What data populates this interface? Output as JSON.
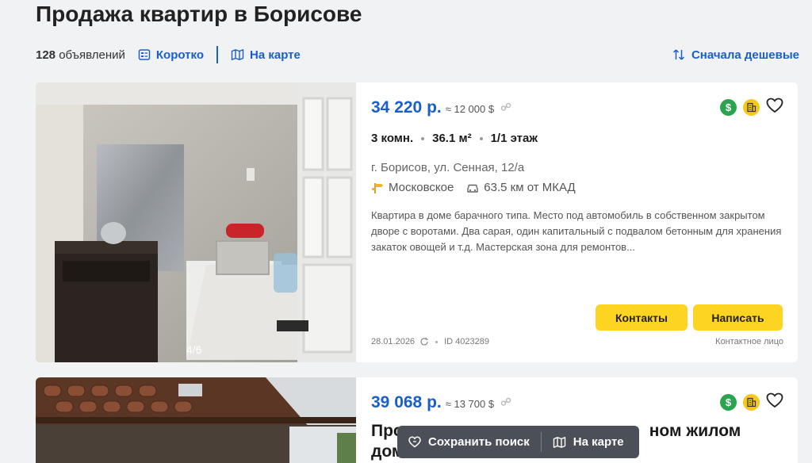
{
  "page": {
    "title": "Продажа квартир в Борисове"
  },
  "toolbar": {
    "count_number": "128",
    "count_label": "объявлений",
    "short_view_label": "Коротко",
    "map_label": "На карте",
    "sort_label": "Сначала дешевые"
  },
  "listings": [
    {
      "price": "34 220 р.",
      "price_usd": "≈ 12 000 $",
      "rooms": "3 комн.",
      "area": "36.1 м²",
      "floor": "1/1 этаж",
      "address": "г. Борисов, ул. Сенная, 12/а",
      "direction": "Московское",
      "distance": "63.5 км от МКАД",
      "description": "Квартира в доме барачного типа. Место под автомобиль в собственном закрытом дворе с воротами. Два сарая, один капитальный с подвалом бетонным для хранения закаток овощей и т.д. Мастерская зона для ремонтов...",
      "photo_counter": "4/6",
      "contacts_label": "Контакты",
      "write_label": "Написать",
      "date": "28.01.2026",
      "id_label": "ID 4023289",
      "seller_type": "Контактное лицо",
      "badge_dollar": "$"
    },
    {
      "price": "39 068 р.",
      "price_usd": "≈ 13 700 $",
      "title_visible": "Про",
      "title_visible_right": "ном жилом",
      "title_line2": "дом",
      "badge_dollar": "$"
    }
  ],
  "floating_bar": {
    "save_search_label": "Сохранить поиск",
    "map_label": "На карте"
  },
  "colors": {
    "accent": "#1a5ec9",
    "button": "#fcd421",
    "badge_green": "#2aa44f",
    "badge_yellow": "#f6c81c",
    "background": "#f1f2f4"
  }
}
